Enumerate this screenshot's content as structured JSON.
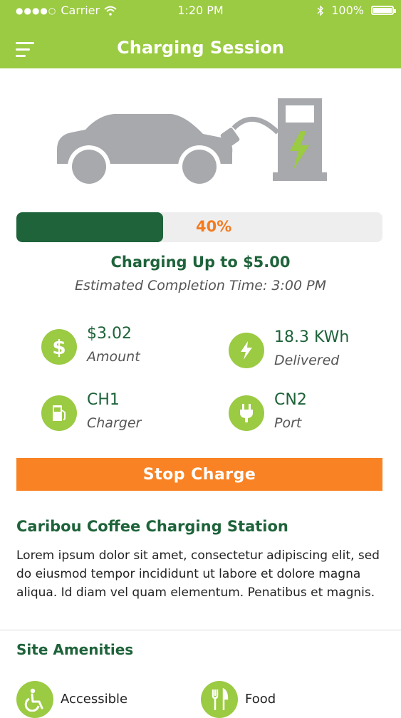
{
  "status_bar": {
    "carrier": "Carrier",
    "time": "1:20 PM",
    "battery": "100%"
  },
  "header": {
    "title": "Charging Session"
  },
  "progress": {
    "label": "40%",
    "fraction": 0.4
  },
  "charging": {
    "limit": "Charging Up to $5.00",
    "eta": "Estimated Completion Time: 3:00 PM"
  },
  "stats": {
    "amount": {
      "value": "$3.02",
      "label": "Amount"
    },
    "energy": {
      "value": "18.3 KWh",
      "label": "Delivered"
    },
    "charger": {
      "value": "CH1",
      "label": "Charger"
    },
    "port": {
      "value": "CN2",
      "label": "Port"
    }
  },
  "actions": {
    "stop": "Stop Charge"
  },
  "station": {
    "name": "Caribou Coffee Charging Station",
    "description": "Lorem ipsum dolor sit amet, consectetur adipiscing elit, sed do eiusmod tempor incididunt ut labore et dolore magna aliqua. Id diam vel quam elementum. Penatibus et magnis."
  },
  "amenities": {
    "title": "Site Amenities",
    "items": [
      {
        "label": "Accessible",
        "icon": "accessible-icon"
      },
      {
        "label": "Food",
        "icon": "food-icon"
      }
    ]
  },
  "colors": {
    "accent": "#9bca43",
    "dark_green": "#1e633a",
    "orange": "#f98324"
  }
}
